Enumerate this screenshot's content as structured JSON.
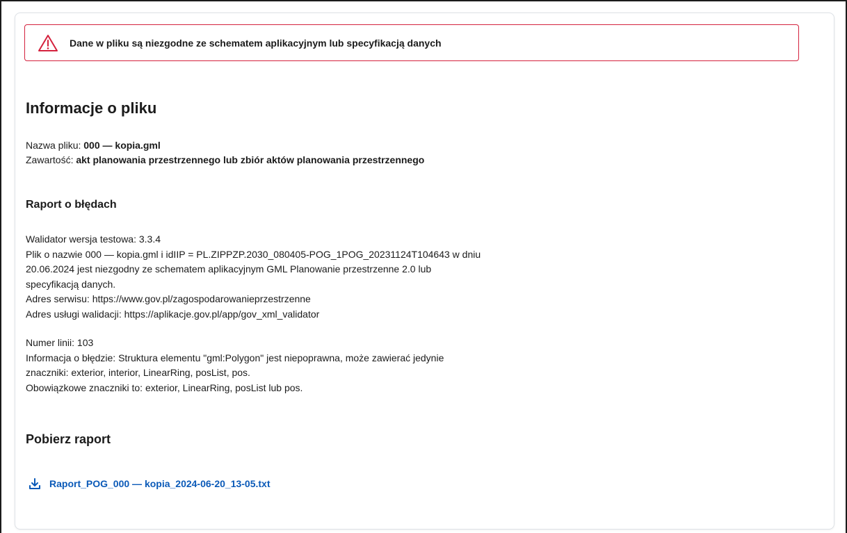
{
  "alert": {
    "icon": "warning-triangle-icon",
    "color": "#d4213d",
    "message": "Dane w pliku są niezgodne ze schematem aplikacyjnym lub specyfikacją danych"
  },
  "file_info": {
    "title": "Informacje o pliku",
    "name_label": "Nazwa pliku:",
    "name_value": "000 — kopia.gml",
    "content_label": "Zawartość:",
    "content_value": "akt planowania przestrzennego lub zbiór aktów planowania przestrzennego"
  },
  "report": {
    "title": "Raport o błędach",
    "validator_version": "Walidator wersja testowa: 3.3.4",
    "summary_line1": "Plik o nazwie 000 — kopia.gml i idIIP = PL.ZIPPZP.2030_080405-POG_1POG_20231124T104643 w dniu",
    "summary_line2": "20.06.2024 jest niezgodny ze schematem aplikacyjnym GML Planowanie przestrzenne 2.0 lub",
    "summary_line3": "specyfikacją danych.",
    "service_address": "Adres serwisu: https://www.gov.pl/zagospodarowanieprzestrzenne",
    "validation_address": "Adres usługi walidacji: https://aplikacje.gov.pl/app/gov_xml_validator",
    "line_number": "Numer linii: 103",
    "error_line1": "Informacja o błędzie: Struktura elementu \"gml:Polygon\" jest niepoprawna, może zawierać jedynie",
    "error_line2": "znaczniki: exterior, interior, LinearRing, posList, pos.",
    "error_line3": "Obowiązkowe znaczniki to: exterior, LinearRing, posList lub pos."
  },
  "download": {
    "title": "Pobierz raport",
    "icon": "download-icon",
    "link_label": "Raport_POG_000 — kopia_2024-06-20_13-05.txt",
    "link_color": "#0b5ab8"
  }
}
